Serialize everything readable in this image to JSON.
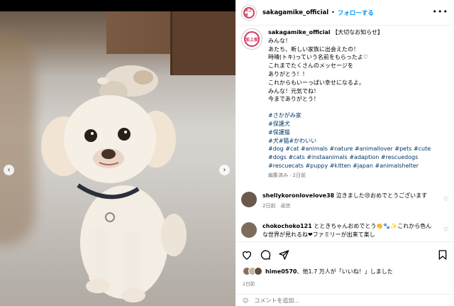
{
  "header": {
    "username": "sakagamike_official",
    "separator": "•",
    "follow_label": "フォローする",
    "more_label": "•••",
    "avatar_text": "坂上家"
  },
  "caption": {
    "username": "sakagamike_official",
    "lines": [
      "【大切なお知らせ】",
      "みんな！",
      "あたち、新しい家族に出会えたの！",
      "時晴(トキ)っていう名前をもらったよ♡",
      "これまでたくさんのメッセージを",
      "ありがとう！！",
      "これからもいーっぱい幸せになるよ。",
      "みんな！元気でね！",
      "今までありがとう！"
    ],
    "tags_jp": [
      "#さかがみ家",
      "#保護犬",
      "#保護猫",
      "#犬#猫#かわいい"
    ],
    "tags_en": "#dog #cat #animals #nature #animallover #pets #cute #dogs #cats #instaanimals #adaption #rescuedogs #rescuecats #puppy #kitten #japan #animalshelter",
    "meta": "編集済み · 2日前"
  },
  "comments": [
    {
      "username": "shellykoronlovelove38",
      "text": "泣きました😢おめでとうございます",
      "meta": "2日前　返信"
    },
    {
      "username": "chokochoko121",
      "text": "とときちゃんおめでとう👏🐾✨これから色んな世界が見れるね❤ファミリーが出来て楽し",
      "meta": ""
    }
  ],
  "likes": {
    "user": "hime0570",
    "text": "、他1.7 万人が「いいね！」しました"
  },
  "date": "2日前",
  "comment_placeholder": "コメントを追加...",
  "colors": {
    "accent": "#0095f6",
    "tag": "#00376b",
    "meta": "#737373"
  }
}
